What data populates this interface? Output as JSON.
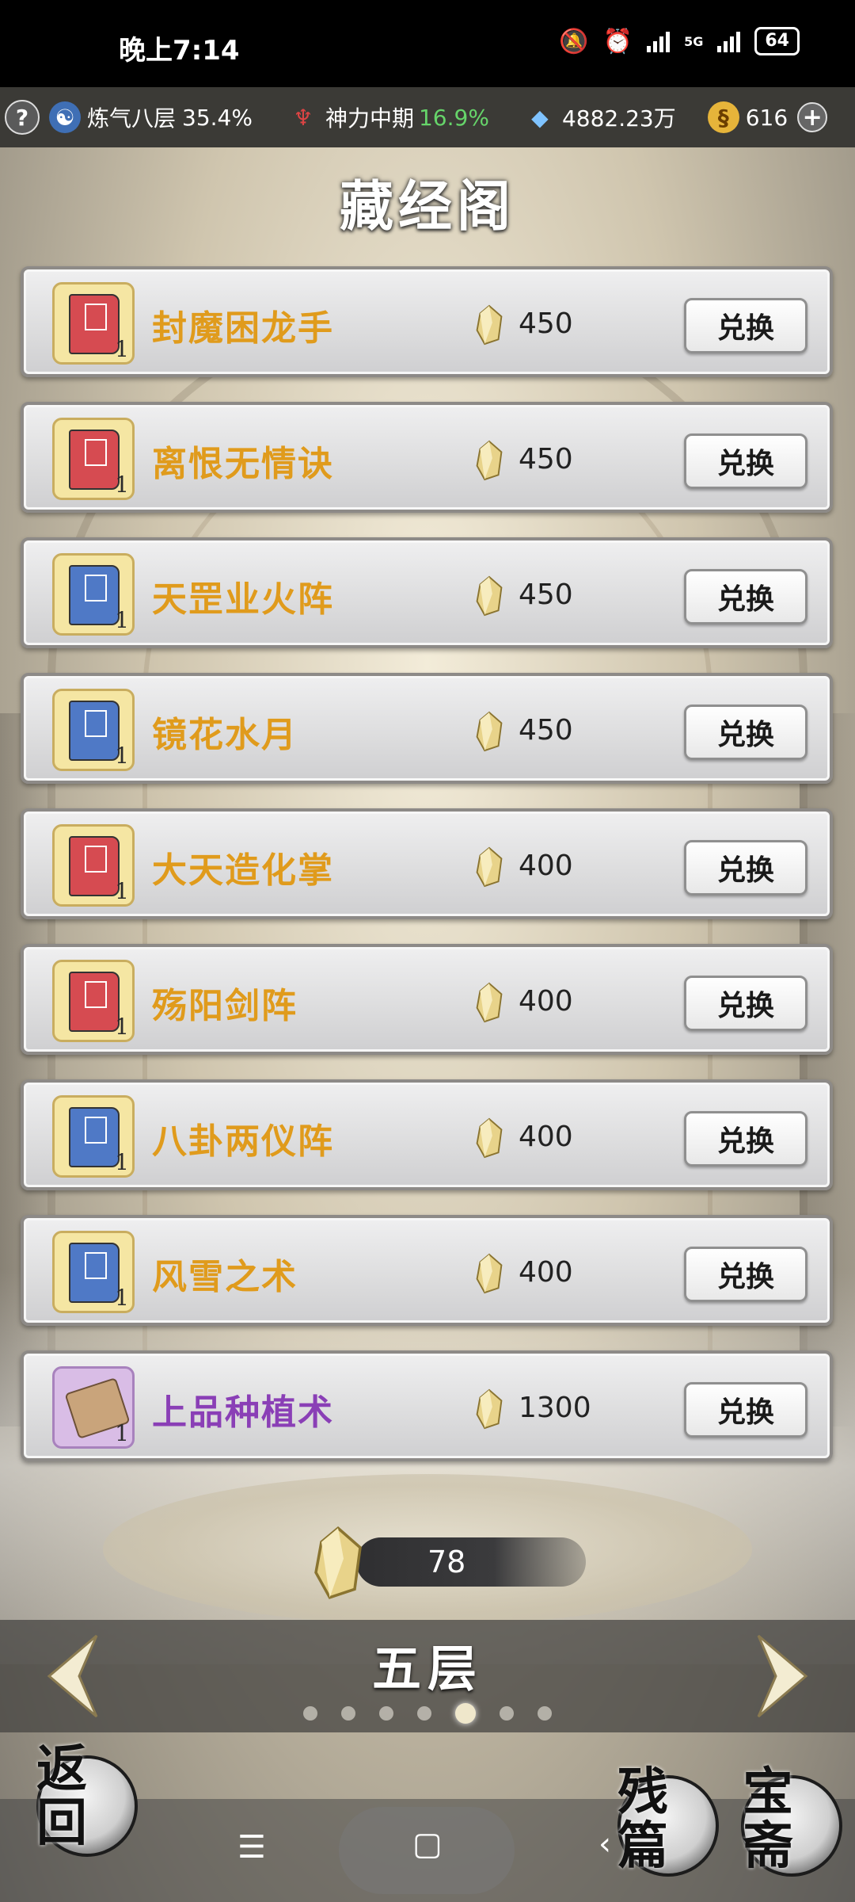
{
  "status_bar": {
    "time": "晚上7:14",
    "network": "5G",
    "battery": "64"
  },
  "resources": {
    "help": "?",
    "realm": "炼气八层",
    "realm_pct": "35.4%",
    "power": "神力中期",
    "power_pct": "16.9%",
    "spirit_stones": "4882.23万",
    "jade": "616",
    "add": "+"
  },
  "page": {
    "title": "藏经阁"
  },
  "exchange_label": "兑换",
  "items": [
    {
      "name": "封魔困龙手",
      "price": "450",
      "qty": "1",
      "icon": "red-book-icon"
    },
    {
      "name": "离恨无情诀",
      "price": "450",
      "qty": "1",
      "icon": "red-book-icon"
    },
    {
      "name": "天罡业火阵",
      "price": "450",
      "qty": "1",
      "icon": "blue-book-icon"
    },
    {
      "name": "镜花水月",
      "price": "450",
      "qty": "1",
      "icon": "blue-book-icon"
    },
    {
      "name": "大天造化掌",
      "price": "400",
      "qty": "1",
      "icon": "red-book-icon"
    },
    {
      "name": "殇阳剑阵",
      "price": "400",
      "qty": "1",
      "icon": "red-book-icon"
    },
    {
      "name": "八卦两仪阵",
      "price": "400",
      "qty": "1",
      "icon": "blue-book-icon"
    },
    {
      "name": "风雪之术",
      "price": "400",
      "qty": "1",
      "icon": "blue-book-icon"
    },
    {
      "name": "上品种植术",
      "price": "1300",
      "qty": "1",
      "icon": "scroll-icon"
    }
  ],
  "currency": {
    "amount": "78"
  },
  "floor": {
    "title": "五层",
    "page_count": 7,
    "active_page": 5
  },
  "buttons": {
    "back": "返回",
    "fragments": "残篇",
    "treasure": "宝斋"
  },
  "colors": {
    "item_name_gold": "#e09b1c",
    "item_name_purple": "#8a3fb6",
    "realm_green": "#66d46a"
  }
}
